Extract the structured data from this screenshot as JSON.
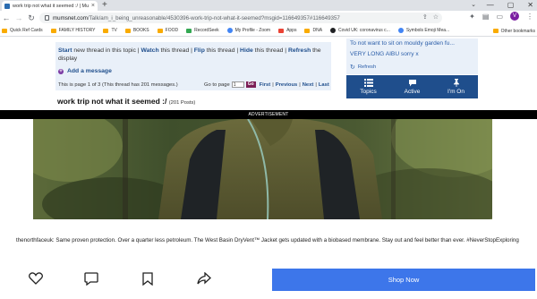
{
  "browser": {
    "tab_title": "work trip not what it seemed :/ | Mum...",
    "tab_close": "×",
    "new_tab": "+",
    "tab_dropdown": "⌄",
    "window_controls": [
      "—",
      "▢",
      "✕"
    ],
    "nav": {
      "back": "←",
      "forward": "→",
      "reload": "↻"
    },
    "url_host": "mumsnet.com",
    "url_path": "/Talk/am_i_being_unreasonable/4530396-work-trip-not-what-it-seemed?msgid=116649357#116649357",
    "omnibox_icons": [
      "⇪",
      "☆"
    ],
    "toolbar_icons": [
      "✦",
      "▤",
      "▭"
    ],
    "avatar_letter": "V",
    "menu": "⋮"
  },
  "bookmarks": [
    {
      "label": "Quick Ref Cards",
      "icon": "folder"
    },
    {
      "label": "FAMILY HISTORY",
      "icon": "folder"
    },
    {
      "label": "TV",
      "icon": "folder"
    },
    {
      "label": "BOOKS",
      "icon": "folder"
    },
    {
      "label": "FOOD",
      "icon": "folder"
    },
    {
      "label": "RecordSeek",
      "icon": "globe"
    },
    {
      "label": "My Profile - Zoom",
      "icon": "globe"
    },
    {
      "label": "Apps",
      "icon": "apps"
    },
    {
      "label": "DNA",
      "icon": "folder"
    },
    {
      "label": "Covid UK: coronavirus c...",
      "icon": "globe"
    },
    {
      "label": "Symbols Emoji Mea...",
      "icon": "page"
    }
  ],
  "bookmarks_overflow": "»",
  "bookmarks_other": "Other bookmarks",
  "thread": {
    "actions": {
      "start": "Start",
      "start_rest": " new thread in this topic | ",
      "watch": "Watch",
      "watch_rest": " this thread | ",
      "flip": "Flip",
      "flip_rest": " this thread | ",
      "hide": "Hide",
      "hide_rest": " this thread | ",
      "refresh": "Refresh",
      "refresh_rest": " the display"
    },
    "add_message": "Add a message",
    "page_info": "This is page 1 of 3 (This thread has 201 messages.)",
    "goto_label": "Go to page",
    "page_value": "1",
    "go_button": "Go",
    "pagination": [
      "First",
      "Previous",
      "Next",
      "Last"
    ],
    "title": "work trip not what it seemed :/",
    "post_count": "(201 Posts)"
  },
  "side": {
    "item1": "To not want to sit on mouldy garden fu...",
    "item2": "VERY LONG AIBU sorry x",
    "refresh": "Refresh",
    "nav": [
      "Topics",
      "Active",
      "I'm On"
    ]
  },
  "ad": {
    "label": "ADVERTISEMENT",
    "caption": "thenorthfaceuk: Same proven protection. Over a quarter less petroleum. The West Basin DryVent™ Jacket gets updated with a biobased membrane. Stay out and feel better than ever. #NeverStopExploring",
    "shop_button": "Shop Now"
  },
  "colors": {
    "panel_bg": "#e9f0f9",
    "link_blue": "#1f4e8c",
    "nav_blue": "#1f4e8c",
    "go_button": "#7b1f56",
    "shop_button": "#3d76ea",
    "ad_bar": "#000000"
  }
}
